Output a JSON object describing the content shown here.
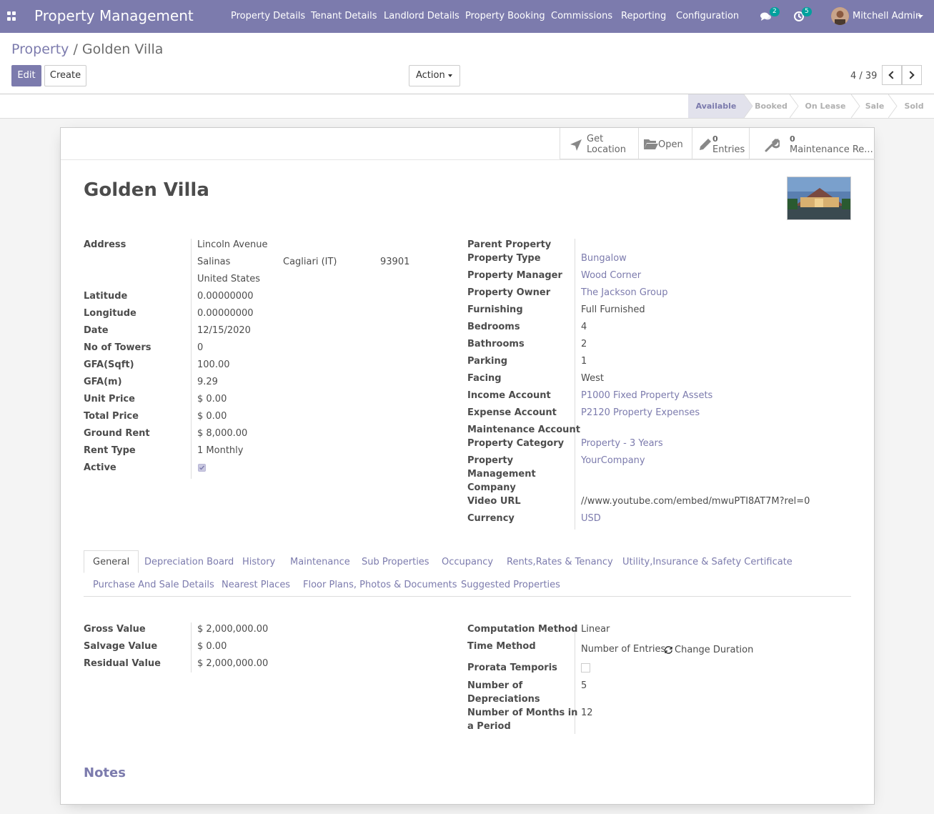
{
  "navbar": {
    "brand": "Property Management",
    "menu": [
      "Property Details",
      "Tenant Details",
      "Landlord Details",
      "Property Booking",
      "Commissions",
      "Reporting",
      "Configuration"
    ],
    "messages_count": "2",
    "activities_count": "5",
    "user": "Mitchell Admin"
  },
  "breadcrumb": {
    "parent": "Property",
    "separator": "/",
    "current": "Golden Villa"
  },
  "toolbar": {
    "edit_label": "Edit",
    "create_label": "Create",
    "action_label": "Action",
    "pager": "4 / 39"
  },
  "stages": [
    "Available",
    "Booked",
    "On Lease",
    "Sale",
    "Sold"
  ],
  "smart_buttons": {
    "location": [
      "Get",
      "Location"
    ],
    "open": "Open",
    "entries_count": "0",
    "entries_label": "Entries",
    "maintenance_count": "0",
    "maintenance_label": "Maintenance Re..."
  },
  "record": {
    "name": "Golden Villa",
    "left": {
      "address_label": "Address",
      "street": "Lincoln Avenue",
      "city": "Salinas",
      "state": "Cagliari (IT)",
      "zip": "93901",
      "country": "United States",
      "fields": [
        {
          "label": "Latitude",
          "value": "0.00000000"
        },
        {
          "label": "Longitude",
          "value": "0.00000000"
        },
        {
          "label": "Date",
          "value": "12/15/2020"
        },
        {
          "label": "No of Towers",
          "value": "0"
        },
        {
          "label": "GFA(Sqft)",
          "value": "100.00"
        },
        {
          "label": "GFA(m)",
          "value": "9.29"
        },
        {
          "label": "Unit Price",
          "value": "$ 0.00"
        },
        {
          "label": "Total Price",
          "value": "$ 0.00"
        },
        {
          "label": "Ground Rent",
          "value": "$ 8,000.00"
        },
        {
          "label": "Rent Type",
          "value": "1 Monthly"
        }
      ],
      "active_label": "Active",
      "active": true
    },
    "right": {
      "parent_property": "Parent Property",
      "property_type_label": "Property Type",
      "property_type": "Bungalow",
      "property_manager_label": "Property Manager",
      "property_manager": "Wood Corner",
      "property_owner_label": "Property Owner",
      "property_owner": "The Jackson Group",
      "furnishing_label": "Furnishing",
      "furnishing": "Full Furnished",
      "bedrooms_label": "Bedrooms",
      "bedrooms": "4",
      "bathrooms_label": "Bathrooms",
      "bathrooms": "2",
      "parking_label": "Parking",
      "parking": "1",
      "facing_label": "Facing",
      "facing": "West",
      "income_account_label": "Income Account",
      "income_account": "P1000 Fixed Property Assets",
      "expense_account_label": "Expense Account",
      "expense_account": "P2120 Property Expenses",
      "maintenance_account_label": "Maintenance Account",
      "property_category_label": "Property Category",
      "property_category": "Property - 3 Years",
      "pm_company_label": [
        "Property",
        "Management",
        "Company"
      ],
      "pm_company": "YourCompany",
      "video_url_label": "Video URL",
      "video_url": "//www.youtube.com/embed/mwuPTI8AT7M?rel=0",
      "currency_label": "Currency",
      "currency": "USD"
    }
  },
  "tabs": {
    "row1": [
      "General",
      "Depreciation Board",
      "History",
      "Maintenance",
      "Sub Properties",
      "Occupancy",
      "Rents,Rates & Tenancy",
      "Utility,Insurance & Safety Certificate"
    ],
    "row2": [
      "Purchase And Sale Details",
      "Nearest Places",
      "Floor Plans, Photos & Documents",
      "Suggested Properties"
    ]
  },
  "general": {
    "gross_value_label": "Gross Value",
    "gross_value": "$ 2,000,000.00",
    "salvage_value_label": "Salvage Value",
    "salvage_value": "$ 0.00",
    "residual_value_label": "Residual Value",
    "residual_value": "$ 2,000,000.00",
    "computation_method_label": "Computation Method",
    "computation_method": "Linear",
    "time_method_label": "Time Method",
    "time_method": "Number of Entries",
    "change_duration_label": "Change Duration",
    "prorata_label": "Prorata Temporis",
    "num_depreciations_label": [
      "Number of",
      "Depreciations"
    ],
    "num_depreciations": "5",
    "months_period_label": [
      "Number of Months in",
      "a Period"
    ],
    "months_period": "12"
  },
  "notes_label": "Notes",
  "colors": {
    "primary": "#7c7bad",
    "badge": "#00a09d"
  }
}
